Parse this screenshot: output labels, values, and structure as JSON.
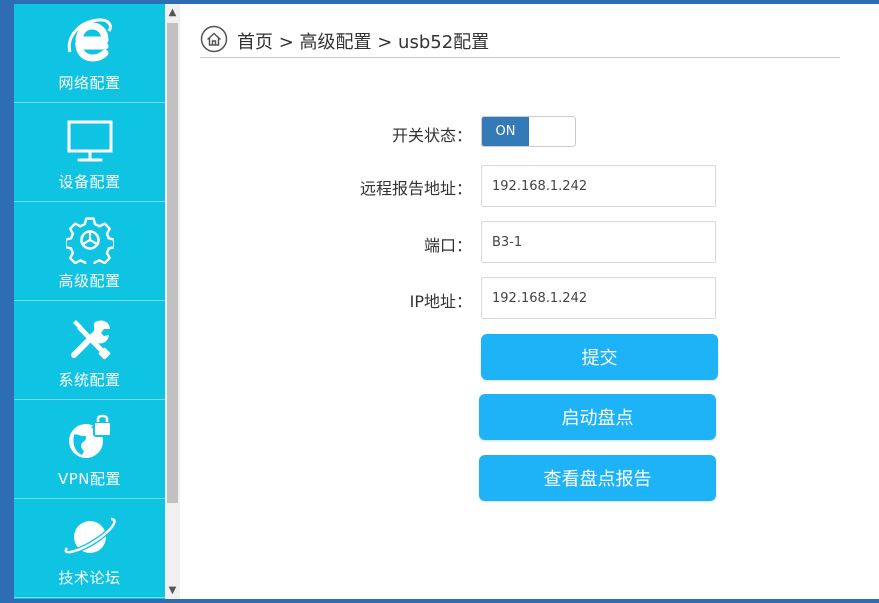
{
  "colors": {
    "sidebar_bg": "#0fc3e3",
    "frame_blue": "#2e6db4",
    "toggle_on": "#337ab7",
    "button_bg": "#1eb3f6"
  },
  "sidebar": {
    "items": [
      {
        "label": "网络配置",
        "icon": "browser-e-icon"
      },
      {
        "label": "设备配置",
        "icon": "monitor-icon"
      },
      {
        "label": "高级配置",
        "icon": "gear-icon"
      },
      {
        "label": "系统配置",
        "icon": "tools-icon"
      },
      {
        "label": "VPN配置",
        "icon": "globe-lock-icon"
      },
      {
        "label": "技术论坛",
        "icon": "planet-icon"
      }
    ]
  },
  "breadcrumb": {
    "text": "首页 > 高级配置 > usb52配置",
    "icon": "home-icon"
  },
  "form": {
    "switch_label": "开关状态：",
    "switch_value": "ON",
    "report_addr_label": "远程报告地址：",
    "report_addr_value": "192.168.1.242",
    "port_label": "端口：",
    "port_value": "B3-1",
    "ip_label": "IP地址：",
    "ip_value": "192.168.1.242"
  },
  "buttons": {
    "submit": "提交",
    "start_inventory": "启动盘点",
    "view_report": "查看盘点报告"
  }
}
